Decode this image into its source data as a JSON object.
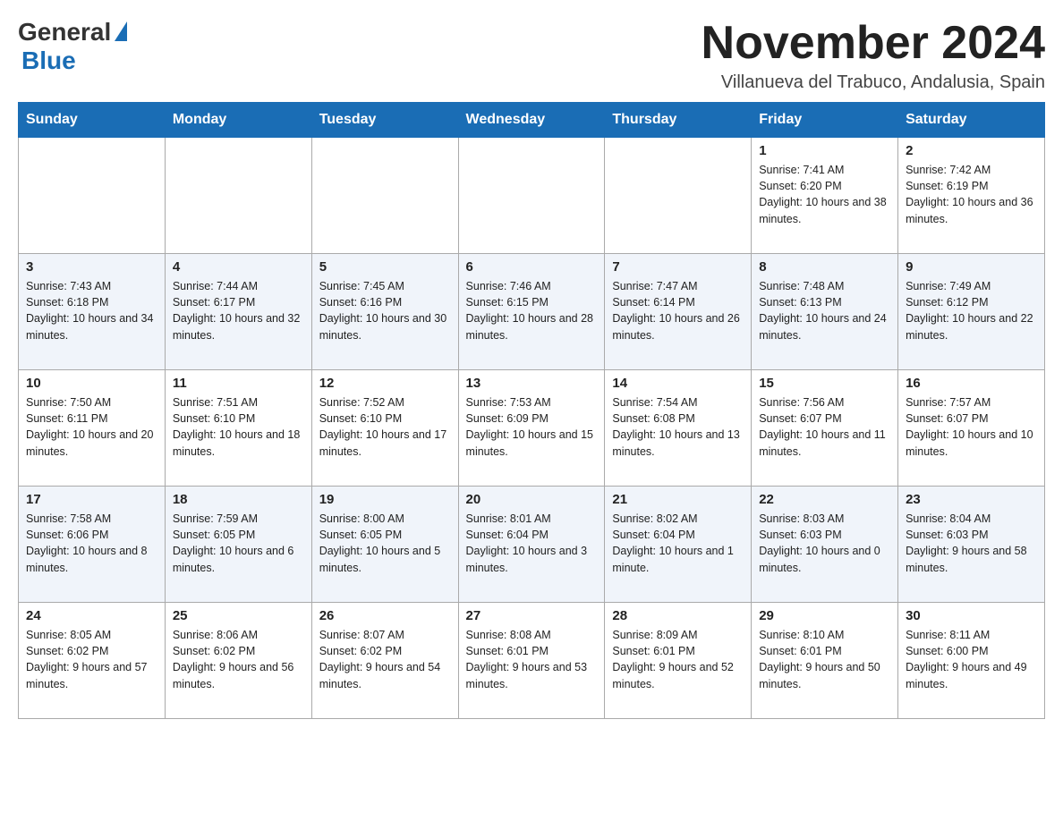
{
  "header": {
    "logo_general": "General",
    "logo_blue": "Blue",
    "month_year": "November 2024",
    "location": "Villanueva del Trabuco, Andalusia, Spain"
  },
  "days_of_week": [
    "Sunday",
    "Monday",
    "Tuesday",
    "Wednesday",
    "Thursday",
    "Friday",
    "Saturday"
  ],
  "weeks": [
    [
      {
        "day": "",
        "info": ""
      },
      {
        "day": "",
        "info": ""
      },
      {
        "day": "",
        "info": ""
      },
      {
        "day": "",
        "info": ""
      },
      {
        "day": "",
        "info": ""
      },
      {
        "day": "1",
        "info": "Sunrise: 7:41 AM\nSunset: 6:20 PM\nDaylight: 10 hours and 38 minutes."
      },
      {
        "day": "2",
        "info": "Sunrise: 7:42 AM\nSunset: 6:19 PM\nDaylight: 10 hours and 36 minutes."
      }
    ],
    [
      {
        "day": "3",
        "info": "Sunrise: 7:43 AM\nSunset: 6:18 PM\nDaylight: 10 hours and 34 minutes."
      },
      {
        "day": "4",
        "info": "Sunrise: 7:44 AM\nSunset: 6:17 PM\nDaylight: 10 hours and 32 minutes."
      },
      {
        "day": "5",
        "info": "Sunrise: 7:45 AM\nSunset: 6:16 PM\nDaylight: 10 hours and 30 minutes."
      },
      {
        "day": "6",
        "info": "Sunrise: 7:46 AM\nSunset: 6:15 PM\nDaylight: 10 hours and 28 minutes."
      },
      {
        "day": "7",
        "info": "Sunrise: 7:47 AM\nSunset: 6:14 PM\nDaylight: 10 hours and 26 minutes."
      },
      {
        "day": "8",
        "info": "Sunrise: 7:48 AM\nSunset: 6:13 PM\nDaylight: 10 hours and 24 minutes."
      },
      {
        "day": "9",
        "info": "Sunrise: 7:49 AM\nSunset: 6:12 PM\nDaylight: 10 hours and 22 minutes."
      }
    ],
    [
      {
        "day": "10",
        "info": "Sunrise: 7:50 AM\nSunset: 6:11 PM\nDaylight: 10 hours and 20 minutes."
      },
      {
        "day": "11",
        "info": "Sunrise: 7:51 AM\nSunset: 6:10 PM\nDaylight: 10 hours and 18 minutes."
      },
      {
        "day": "12",
        "info": "Sunrise: 7:52 AM\nSunset: 6:10 PM\nDaylight: 10 hours and 17 minutes."
      },
      {
        "day": "13",
        "info": "Sunrise: 7:53 AM\nSunset: 6:09 PM\nDaylight: 10 hours and 15 minutes."
      },
      {
        "day": "14",
        "info": "Sunrise: 7:54 AM\nSunset: 6:08 PM\nDaylight: 10 hours and 13 minutes."
      },
      {
        "day": "15",
        "info": "Sunrise: 7:56 AM\nSunset: 6:07 PM\nDaylight: 10 hours and 11 minutes."
      },
      {
        "day": "16",
        "info": "Sunrise: 7:57 AM\nSunset: 6:07 PM\nDaylight: 10 hours and 10 minutes."
      }
    ],
    [
      {
        "day": "17",
        "info": "Sunrise: 7:58 AM\nSunset: 6:06 PM\nDaylight: 10 hours and 8 minutes."
      },
      {
        "day": "18",
        "info": "Sunrise: 7:59 AM\nSunset: 6:05 PM\nDaylight: 10 hours and 6 minutes."
      },
      {
        "day": "19",
        "info": "Sunrise: 8:00 AM\nSunset: 6:05 PM\nDaylight: 10 hours and 5 minutes."
      },
      {
        "day": "20",
        "info": "Sunrise: 8:01 AM\nSunset: 6:04 PM\nDaylight: 10 hours and 3 minutes."
      },
      {
        "day": "21",
        "info": "Sunrise: 8:02 AM\nSunset: 6:04 PM\nDaylight: 10 hours and 1 minute."
      },
      {
        "day": "22",
        "info": "Sunrise: 8:03 AM\nSunset: 6:03 PM\nDaylight: 10 hours and 0 minutes."
      },
      {
        "day": "23",
        "info": "Sunrise: 8:04 AM\nSunset: 6:03 PM\nDaylight: 9 hours and 58 minutes."
      }
    ],
    [
      {
        "day": "24",
        "info": "Sunrise: 8:05 AM\nSunset: 6:02 PM\nDaylight: 9 hours and 57 minutes."
      },
      {
        "day": "25",
        "info": "Sunrise: 8:06 AM\nSunset: 6:02 PM\nDaylight: 9 hours and 56 minutes."
      },
      {
        "day": "26",
        "info": "Sunrise: 8:07 AM\nSunset: 6:02 PM\nDaylight: 9 hours and 54 minutes."
      },
      {
        "day": "27",
        "info": "Sunrise: 8:08 AM\nSunset: 6:01 PM\nDaylight: 9 hours and 53 minutes."
      },
      {
        "day": "28",
        "info": "Sunrise: 8:09 AM\nSunset: 6:01 PM\nDaylight: 9 hours and 52 minutes."
      },
      {
        "day": "29",
        "info": "Sunrise: 8:10 AM\nSunset: 6:01 PM\nDaylight: 9 hours and 50 minutes."
      },
      {
        "day": "30",
        "info": "Sunrise: 8:11 AM\nSunset: 6:00 PM\nDaylight: 9 hours and 49 minutes."
      }
    ]
  ]
}
